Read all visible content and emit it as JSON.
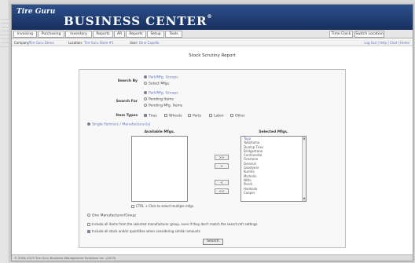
{
  "header": {
    "brand_small": "Tire Guru",
    "brand_big": "BUSINESS CENTER",
    "brand_tm": "®"
  },
  "nav": {
    "tabs": [
      "Invoicing",
      "Purchasing",
      "Inventory",
      "Reports",
      "AR",
      "Reports",
      "Setup",
      "Tools"
    ],
    "right_buttons": [
      "Time Clock",
      "Switch Location"
    ]
  },
  "filters": {
    "company_label": "Company:",
    "company_value": "Tire Guru Demo",
    "location_label": "Location:",
    "location_value": "Tire Guru Store #1",
    "user_label": "User:",
    "user_value": "Dino Capello",
    "links": "Log Out | Help | Chat | Home"
  },
  "page": {
    "title": "Stock Scrutiny Report"
  },
  "form": {
    "search_by_label": "Search By",
    "search_by_options": [
      "Part/Mfg. Groups",
      "Select Mfgs."
    ],
    "search_for_label": "Search For",
    "search_for_options": [
      "Part/Mfg. Groups",
      "Pending Items",
      "Pending Mfg. Items"
    ],
    "item_types_label": "Item Types",
    "item_types": [
      "Tires",
      "Wheels",
      "Parts",
      "Labor",
      "Other"
    ],
    "single_mfg_option": "Single Partners / Manufacturer(s)",
    "available_title": "Available Mfgs.",
    "selected_title": "Selected Mfgs.",
    "selected_items": [
      "Toyo",
      "Yokohama",
      "Dunlop Tires",
      "Bridgestone",
      "Continental",
      "Firestone",
      "General",
      "Goodyear",
      "Kumho",
      "Michelin",
      "Nitto",
      "Pirelli",
      "Hankook",
      "Cooper"
    ],
    "move_buttons": [
      ">>",
      ">",
      "<",
      "<<"
    ],
    "ctrl_hint": "CTRL + Click to select multiple mfgs.",
    "group_option": "One Manufacturer/Group",
    "check_options": [
      "Include all items from the selected manufacturer group, even if they don't match the search mfr settings",
      "Include all stock and/or quantities when considering similar amounts"
    ],
    "search_button": "Search"
  },
  "footer": {
    "text": "© 2004-2013 Tire Guru Business Management Solutions Inc. (2013)"
  }
}
